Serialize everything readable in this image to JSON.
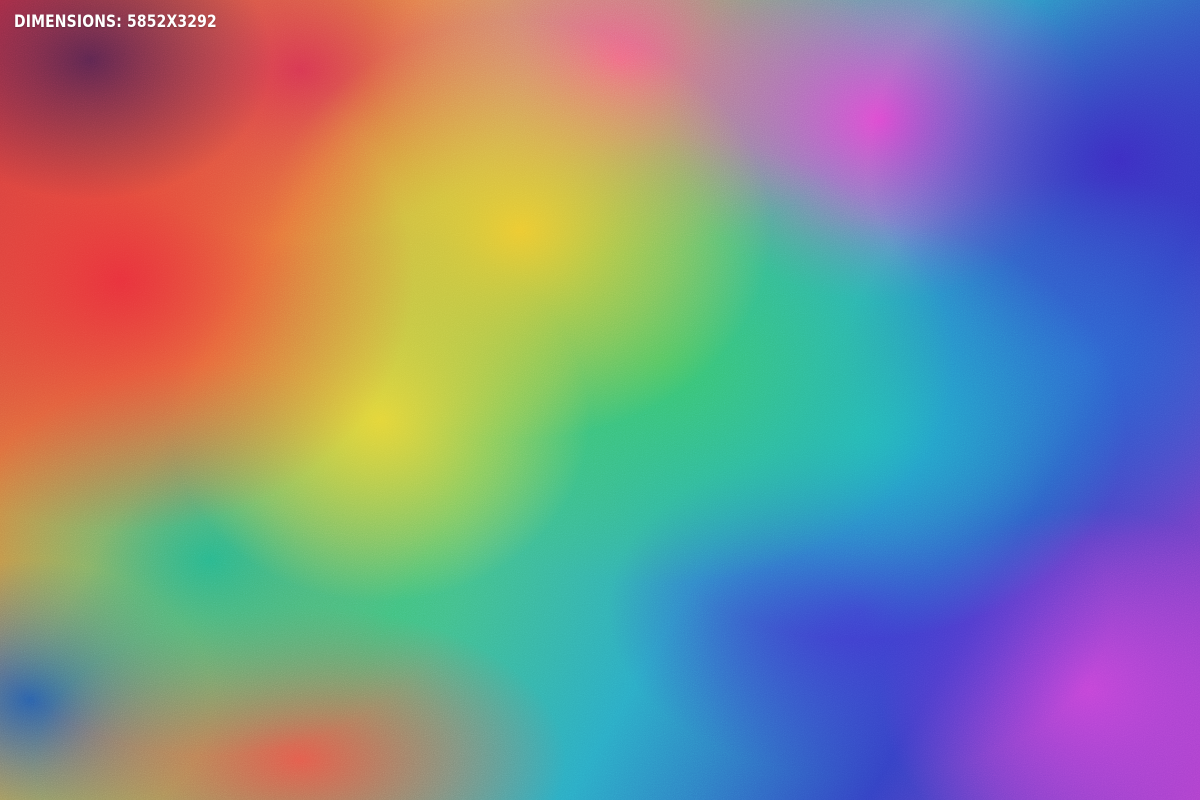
{
  "caption": {
    "text": "DIMENSIONS: 5852X3292"
  },
  "colors": {
    "red": "#e8303a",
    "orange": "#ecc830",
    "yellow": "#e3d437",
    "green": "#39c46a",
    "teal": "#1fb2c8",
    "blue": "#2d63cf",
    "indigo": "#3a2cc0",
    "magenta": "#e04ad0",
    "pink": "#f0608c",
    "violet": "#c243d6"
  }
}
